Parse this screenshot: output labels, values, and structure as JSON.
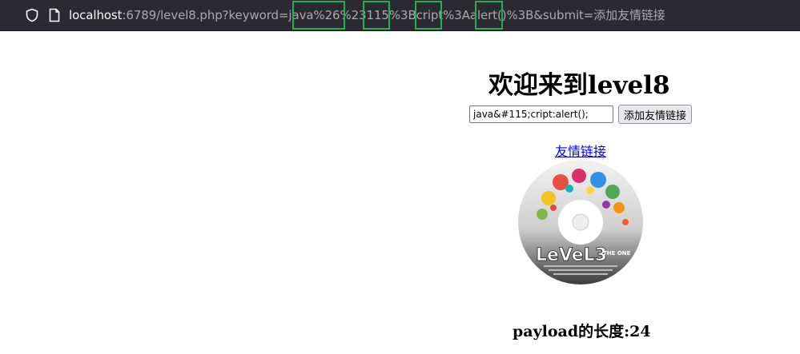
{
  "browser": {
    "url_host": "localhost",
    "url_rest": ":6789/level8.php?keyword=java%26%23115%3Bcript%3Aalert()%3B&submit=添加友情链接",
    "shield_icon": "shield-icon",
    "page_icon": "page-icon",
    "highlight_color": "#22b14c"
  },
  "page": {
    "title": "欢迎来到level8",
    "keyword_value": "java&#115;cript:alert();",
    "submit_label": "添加友情链接",
    "link_text": "友情链接",
    "image_text": "LeVeL3",
    "image_subtext": "THE ONE",
    "payload_label": "payload的长度:24",
    "link_color": "#0000ee"
  }
}
